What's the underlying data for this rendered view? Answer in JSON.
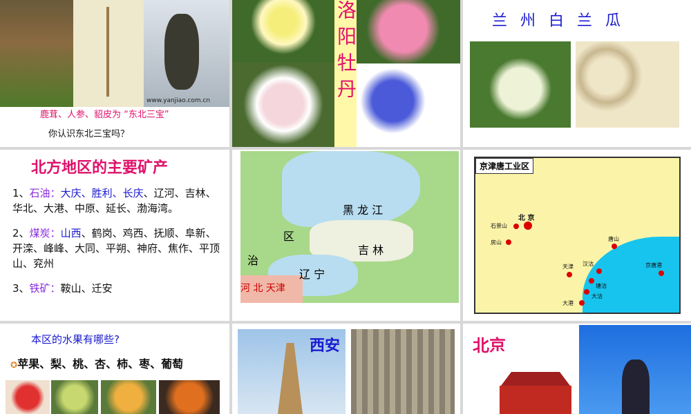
{
  "p1": {
    "caption": "鹿茸、人参、貂皮为 “东北三宝”",
    "question": "你认识东北三宝吗？",
    "watermark": "www.yanjiao.com.cn"
  },
  "p2": {
    "title": "洛阳牡丹"
  },
  "p3": {
    "title": "兰 州 白 兰 瓜"
  },
  "p4": {
    "title": "北方地区的主要矿产",
    "item1": {
      "num": "1、",
      "cat": "石油：",
      "hi": "大庆、胜利、长庆",
      "rest": "、辽河、吉林、华北、大港、中原、延长、渤海湾。"
    },
    "item2": {
      "num": "2、",
      "cat": "煤炭：",
      "hi": "山西",
      "rest": "、鹤岗、鸡西、抚顺、阜新、开滦、峰峰、大同、平朔、神府、焦作、平顶山、兖州"
    },
    "item3": {
      "num": "3、",
      "cat": "铁矿：",
      "rest": "鞍山、迁安"
    }
  },
  "p5": {
    "labels": [
      "黑 龙 江",
      "吉 林",
      "辽 宁",
      "区",
      "治",
      "河 北 天津"
    ]
  },
  "p6": {
    "title": "京津唐工业区",
    "cities": [
      "北 京",
      "石景山",
      "房山",
      "唐山",
      "天津",
      "汉沽",
      "塘沽",
      "大沽",
      "大港",
      "京唐港"
    ]
  },
  "p7": {
    "question": "本区的水果有哪些?",
    "fruits": "苹果、梨、桃、杏、柿、枣、葡萄"
  },
  "p8": {
    "title": "西安"
  },
  "p9": {
    "title": "北京"
  }
}
